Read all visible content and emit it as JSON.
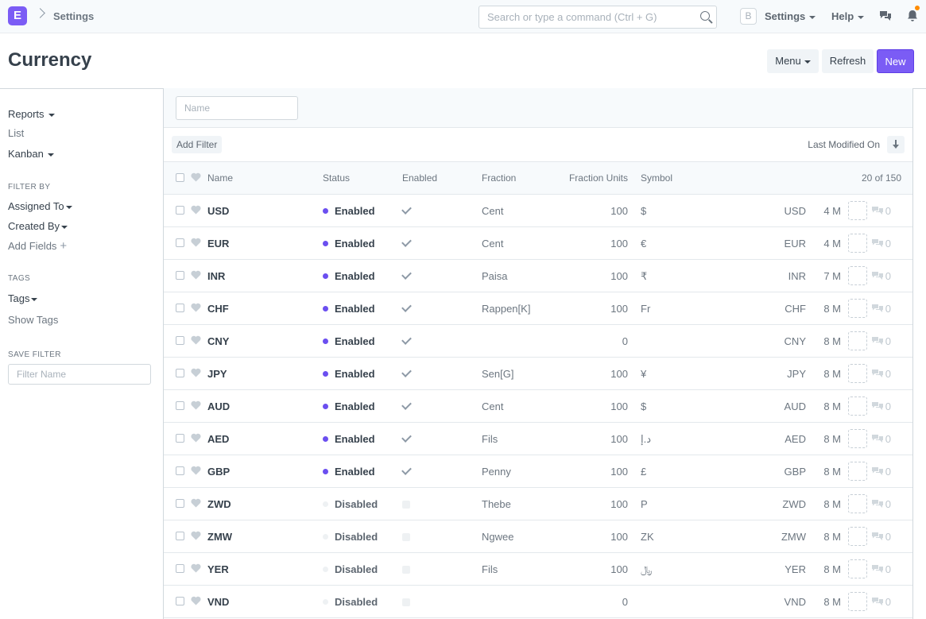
{
  "navbar": {
    "logo_letter": "E",
    "breadcrumb": "Settings",
    "search_placeholder": "Search or type a command (Ctrl + G)",
    "avatar_letter": "B",
    "settings_label": "Settings",
    "help_label": "Help",
    "notification_dot_color": "#ff8c00"
  },
  "page": {
    "title": "Currency",
    "menu_label": "Menu",
    "refresh_label": "Refresh",
    "new_label": "New",
    "accent_color": "#7b5cf5"
  },
  "sidebar": {
    "reports": "Reports",
    "list": "List",
    "kanban": "Kanban",
    "filter_by_heading": "FILTER BY",
    "assigned_to": "Assigned To",
    "created_by": "Created By",
    "add_fields": "Add Fields",
    "tags_heading": "TAGS",
    "tags": "Tags",
    "show_tags": "Show Tags",
    "save_filter_heading": "SAVE FILTER",
    "filter_name_placeholder": "Filter Name"
  },
  "list": {
    "name_filter_placeholder": "Name",
    "add_filter": "Add Filter",
    "sort_label": "Last Modified On",
    "columns": {
      "name": "Name",
      "status": "Status",
      "enabled": "Enabled",
      "fraction": "Fraction",
      "fraction_units": "Fraction Units",
      "symbol": "Symbol"
    },
    "count": "20 of 150",
    "status_colors": {
      "Enabled": "#6b4ff0",
      "Disabled": "#eef1f3"
    },
    "rows": [
      {
        "name": "USD",
        "status": "Enabled",
        "enabled": true,
        "fraction": "Cent",
        "units": "100",
        "symbol": "$",
        "code": "USD",
        "time": "4 M",
        "comments": "0"
      },
      {
        "name": "EUR",
        "status": "Enabled",
        "enabled": true,
        "fraction": "Cent",
        "units": "100",
        "symbol": "€",
        "code": "EUR",
        "time": "4 M",
        "comments": "0"
      },
      {
        "name": "INR",
        "status": "Enabled",
        "enabled": true,
        "fraction": "Paisa",
        "units": "100",
        "symbol": "₹",
        "code": "INR",
        "time": "7 M",
        "comments": "0"
      },
      {
        "name": "CHF",
        "status": "Enabled",
        "enabled": true,
        "fraction": "Rappen[K]",
        "units": "100",
        "symbol": "Fr",
        "code": "CHF",
        "time": "8 M",
        "comments": "0"
      },
      {
        "name": "CNY",
        "status": "Enabled",
        "enabled": true,
        "fraction": "",
        "units": "0",
        "symbol": "",
        "code": "CNY",
        "time": "8 M",
        "comments": "0"
      },
      {
        "name": "JPY",
        "status": "Enabled",
        "enabled": true,
        "fraction": "Sen[G]",
        "units": "100",
        "symbol": "¥",
        "code": "JPY",
        "time": "8 M",
        "comments": "0"
      },
      {
        "name": "AUD",
        "status": "Enabled",
        "enabled": true,
        "fraction": "Cent",
        "units": "100",
        "symbol": "$",
        "code": "AUD",
        "time": "8 M",
        "comments": "0"
      },
      {
        "name": "AED",
        "status": "Enabled",
        "enabled": true,
        "fraction": "Fils",
        "units": "100",
        "symbol": "د.إ",
        "code": "AED",
        "time": "8 M",
        "comments": "0"
      },
      {
        "name": "GBP",
        "status": "Enabled",
        "enabled": true,
        "fraction": "Penny",
        "units": "100",
        "symbol": "£",
        "code": "GBP",
        "time": "8 M",
        "comments": "0"
      },
      {
        "name": "ZWD",
        "status": "Disabled",
        "enabled": false,
        "fraction": "Thebe",
        "units": "100",
        "symbol": "P",
        "code": "ZWD",
        "time": "8 M",
        "comments": "0"
      },
      {
        "name": "ZMW",
        "status": "Disabled",
        "enabled": false,
        "fraction": "Ngwee",
        "units": "100",
        "symbol": "ZK",
        "code": "ZMW",
        "time": "8 M",
        "comments": "0"
      },
      {
        "name": "YER",
        "status": "Disabled",
        "enabled": false,
        "fraction": "Fils",
        "units": "100",
        "symbol": "﷼",
        "code": "YER",
        "time": "8 M",
        "comments": "0"
      },
      {
        "name": "VND",
        "status": "Disabled",
        "enabled": false,
        "fraction": "",
        "units": "0",
        "symbol": "",
        "code": "VND",
        "time": "8 M",
        "comments": "0"
      }
    ]
  }
}
